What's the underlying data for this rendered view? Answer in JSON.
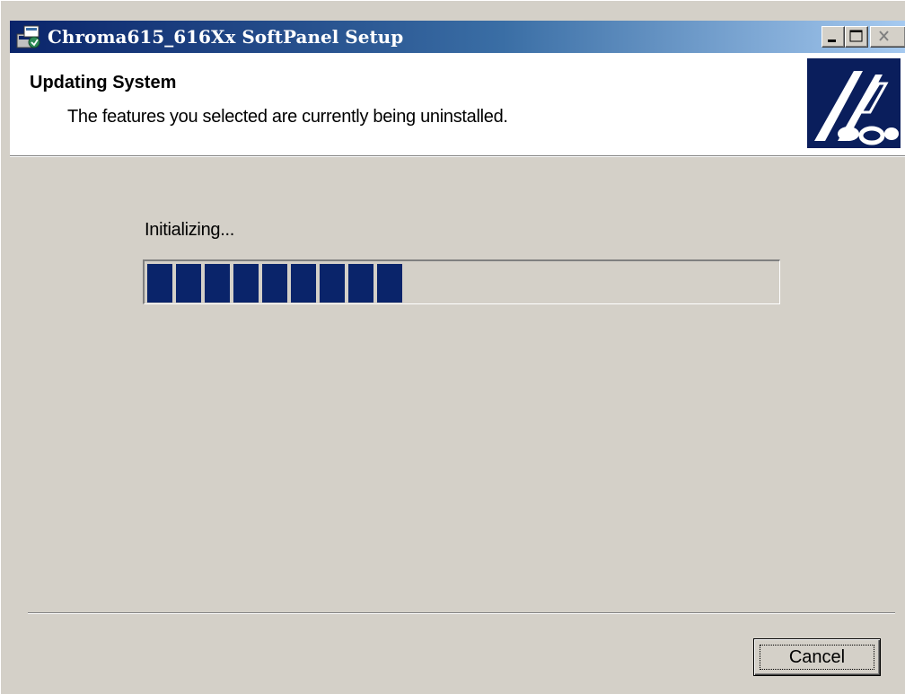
{
  "window": {
    "title": "Chroma615_616Xx SoftPanel Setup",
    "icon": "setup-package-icon",
    "controls": {
      "minimize": "minimize-icon",
      "maximize": "maximize-icon",
      "close": "close-icon"
    }
  },
  "header": {
    "title": "Updating System",
    "subtitle": "The features you selected are currently being uninstalled.",
    "logo": "installer-banner-logo"
  },
  "progress": {
    "status_text": "Initializing...",
    "fraction": 0.41
  },
  "footer": {
    "cancel_label": "Cancel"
  },
  "colors": {
    "titlebar_start": "#0a246a",
    "titlebar_end": "#a6caf0",
    "dialog_bg": "#d4d0c8",
    "progress_fill": "#0a246a"
  }
}
